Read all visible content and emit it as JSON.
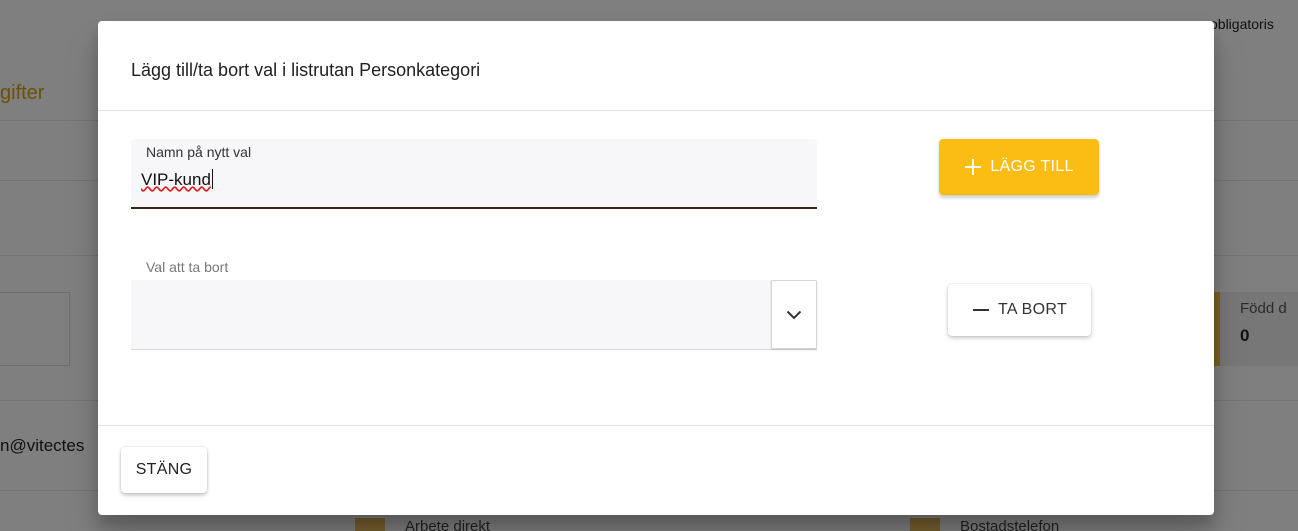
{
  "background": {
    "section_title": "gifter",
    "email_fragment": "n@vitectes",
    "required_note": "obligatoris",
    "born_label": "Född d",
    "born_value": "0",
    "bottom_left": "Arbete direkt",
    "bottom_right": "Bostadstelefon"
  },
  "dialog": {
    "title": "Lägg till/ta bort val i listrutan Personkategori",
    "new_value_field": {
      "label": "Namn på nytt val",
      "value": "VIP-kund"
    },
    "remove_field": {
      "label": "Val att ta bort",
      "selected": ""
    },
    "add_button": {
      "label": "LÄGG TILL",
      "icon": "plus-icon"
    },
    "remove_button": {
      "label": "TA BORT",
      "icon": "minus-icon"
    },
    "close_button": {
      "label": "STÄNG"
    }
  },
  "colors": {
    "accent": "#fbbd14",
    "accent_text": "#d9a400",
    "overlay": "rgba(0,0,0,0.5)"
  }
}
